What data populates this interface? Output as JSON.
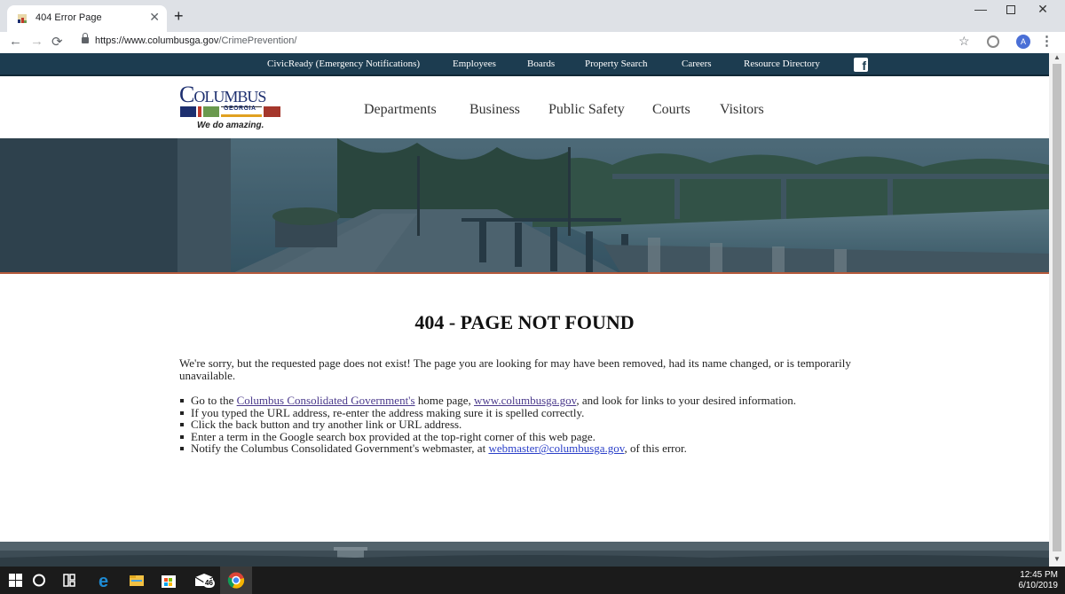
{
  "browser": {
    "tab_title": "404 Error Page",
    "tab_close": "✕",
    "new_tab": "+",
    "url_host": "https://www.columbusga.gov",
    "url_path": "/CrimePrevention/",
    "profile_initial": "A"
  },
  "topnav": {
    "items": [
      "CivicReady (Emergency Notifications)",
      "Employees",
      "Boards",
      "Property Search",
      "Careers",
      "Resource Directory"
    ],
    "facebook_glyph": "f"
  },
  "logo": {
    "wordmark": "Columbus",
    "state": "GEORGIA",
    "tagline": "We do amazing."
  },
  "mainnav": {
    "items": [
      "Departments",
      "Business",
      "Public Safety",
      "Courts",
      "Visitors"
    ]
  },
  "error": {
    "title": "404 - PAGE NOT FOUND",
    "lead": "We're sorry, but the requested page does not exist! The page you are looking for may have been removed, had its name changed, or is temporarily unavailable.",
    "item1_pre": "Go to the ",
    "item1_link1": "Columbus Consolidated Government's",
    "item1_mid": " home page, ",
    "item1_link2": "www.columbusga.gov",
    "item1_post": ", and look for links to your desired information.",
    "item2": "If you typed the URL address, re-enter the address making sure it is spelled correctly.",
    "item3": "Click the back button and try another link or URL address.",
    "item4": "Enter a term in the Google search box provided at the top-right corner of this web page.",
    "item5_pre": "Notify the Columbus Consolidated Government's webmaster, at ",
    "item5_link": "webmaster@columbusga.gov",
    "item5_post": ", of this error."
  },
  "taskbar": {
    "mail_badge": "46",
    "time": "12:45 PM",
    "date": "6/10/2019"
  },
  "colors": {
    "topnav_bg": "#1c3c50",
    "brand_blue": "#1d2f6f",
    "hero_rule": "#b55a3c",
    "link_visited": "#4b3a8c",
    "link": "#2a3fc8"
  }
}
